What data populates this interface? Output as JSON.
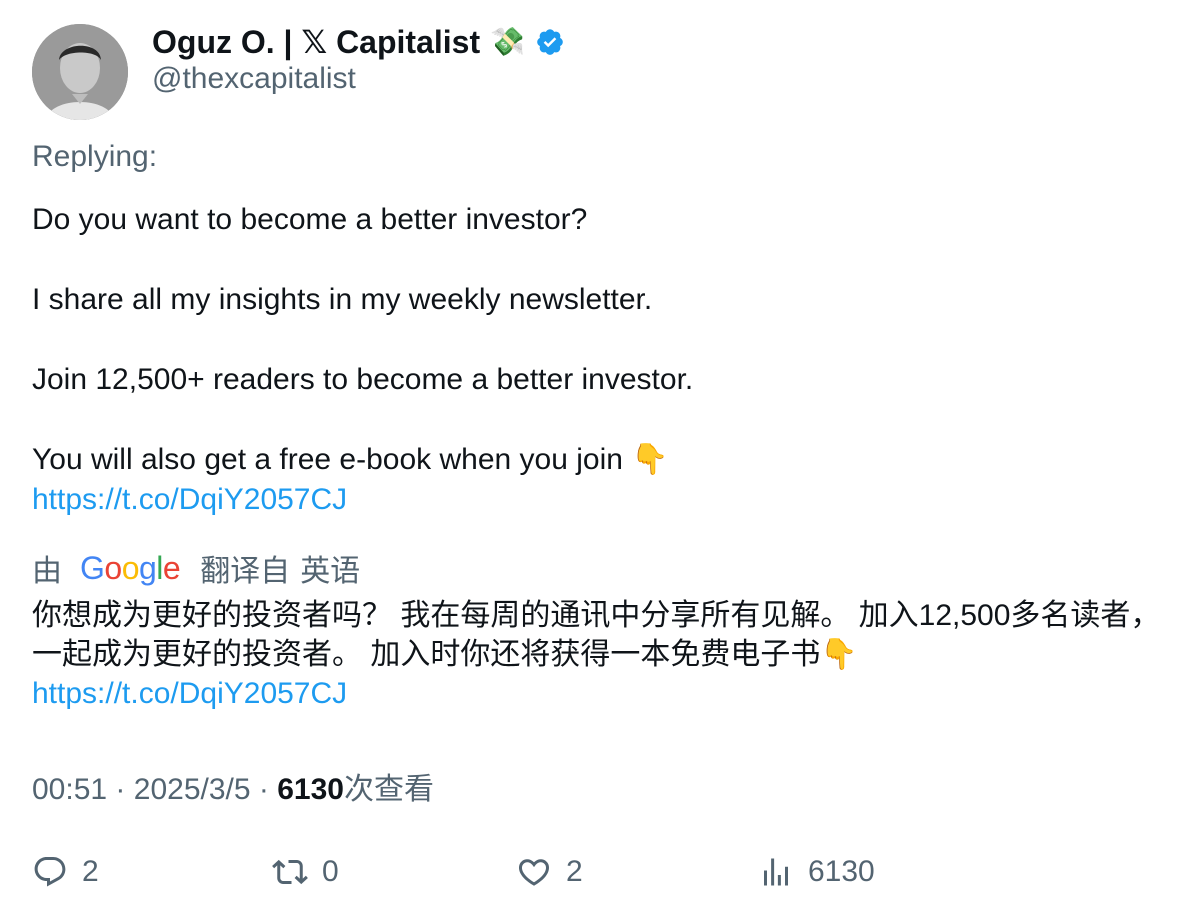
{
  "author": {
    "name": "Oguz O. | 𝕏 Capitalist",
    "name_emoji": "💸",
    "handle": "@thexcapitalist",
    "verified_icon": "verified-badge-icon",
    "verified_color": "#1d9bf0"
  },
  "replying_label": "Replying:",
  "tweet": {
    "line1": "Do you want to become a better investor?",
    "line2": "I share all my insights in my weekly newsletter.",
    "line3": "Join 12,500+ readers to become a better investor.",
    "line4": "You will also get a free e-book when you join 👇",
    "link": "https://t.co/DqiY2057CJ"
  },
  "translation": {
    "prefix": "由",
    "provider_letters": [
      "G",
      "o",
      "o",
      "g",
      "l",
      "e"
    ],
    "provider_colors": [
      "#4285F4",
      "#EA4335",
      "#FBBC05",
      "#4285F4",
      "#34A853",
      "#EA4335"
    ],
    "label": "翻译自",
    "source_language": "英语",
    "text": "你想成为更好的投资者吗？ 我在每周的通讯中分享所有见解。 加入12,500多名读者，一起成为更好的投资者。 加入时你还将获得一本免费电子书👇",
    "link": "https://t.co/DqiY2057CJ"
  },
  "meta": {
    "time": "00:51",
    "separator": "·",
    "date": "2025/3/5",
    "views_count": "6130",
    "views_label": "次查看"
  },
  "actions": {
    "replies": "2",
    "reposts": "0",
    "likes": "2",
    "views": "6130"
  },
  "colors": {
    "text_primary": "#0f1419",
    "text_secondary": "#536471",
    "link": "#1d9bf0"
  }
}
